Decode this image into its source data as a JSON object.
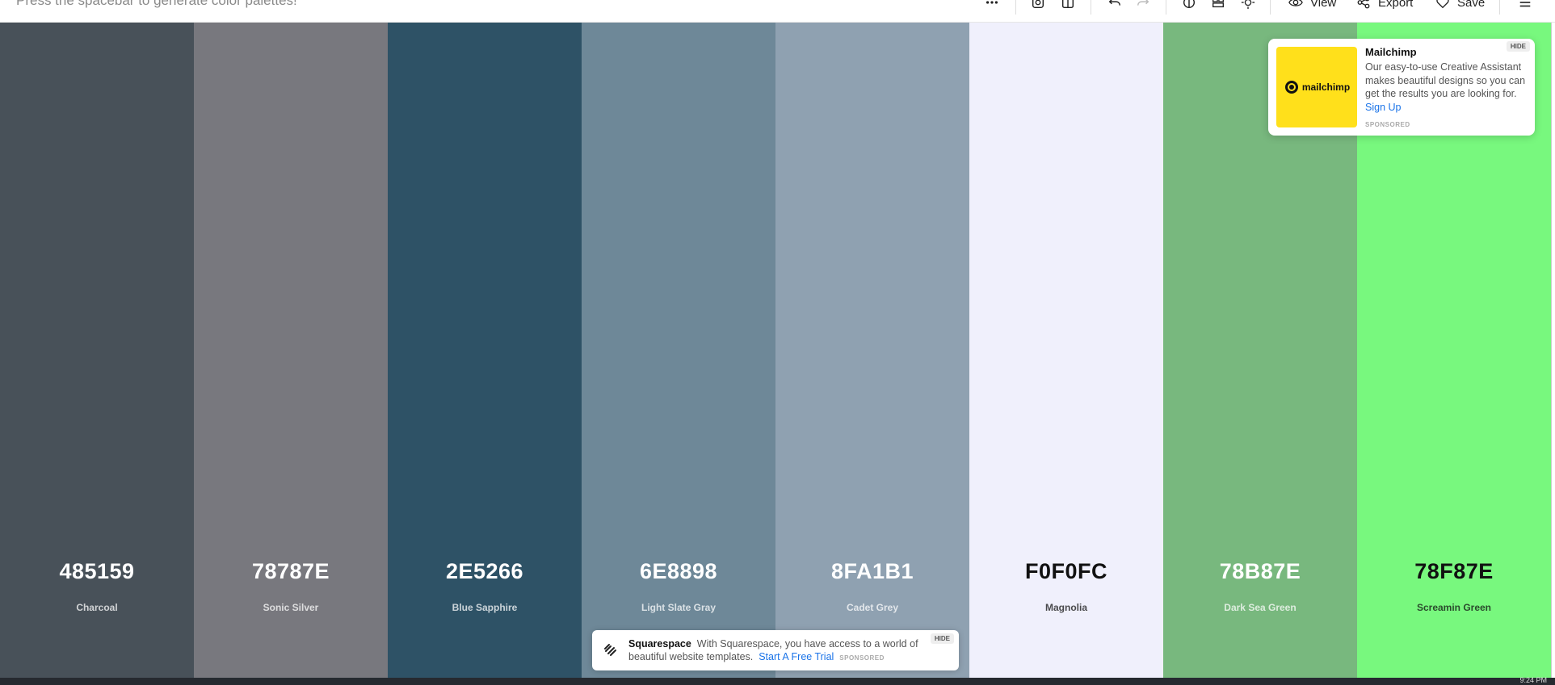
{
  "topbar": {
    "hint": "Press the spacebar to generate color palettes!",
    "view_label": "View",
    "export_label": "Export",
    "save_label": "Save"
  },
  "palette": [
    {
      "hex": "485159",
      "name": "Charcoal",
      "bg": "#485159",
      "fg": "#ffffff"
    },
    {
      "hex": "78787E",
      "name": "Sonic Silver",
      "bg": "#78787E",
      "fg": "#ffffff"
    },
    {
      "hex": "2E5266",
      "name": "Blue Sapphire",
      "bg": "#2E5266",
      "fg": "#ffffff"
    },
    {
      "hex": "6E8898",
      "name": "Light Slate Gray",
      "bg": "#6E8898",
      "fg": "#ffffff"
    },
    {
      "hex": "8FA1B1",
      "name": "Cadet Grey",
      "bg": "#8FA1B1",
      "fg": "#ffffff"
    },
    {
      "hex": "F0F0FC",
      "name": "Magnolia",
      "bg": "#F0F0FC",
      "fg": "#111111"
    },
    {
      "hex": "78B87E",
      "name": "Dark Sea Green",
      "bg": "#78B87E",
      "fg": "#ffffff"
    },
    {
      "hex": "78F87E",
      "name": "Screamin Green",
      "bg": "#78F87E",
      "fg": "#111111"
    }
  ],
  "ad_mailchimp": {
    "title": "Mailchimp",
    "body": "Our easy-to-use Creative Assistant makes beautiful designs so you can get the results you are looking for.",
    "link": "Sign Up",
    "sponsored": "SPONSORED",
    "hide": "HIDE",
    "logo_text": "mailchimp"
  },
  "ad_squarespace": {
    "title": "Squarespace",
    "body": "With Squarespace, you have access to a world of beautiful website templates.",
    "link": "Start A Free Trial",
    "sponsored": "SPONSORED",
    "hide": "HIDE"
  },
  "taskbar": {
    "clock": "9:24 PM"
  }
}
